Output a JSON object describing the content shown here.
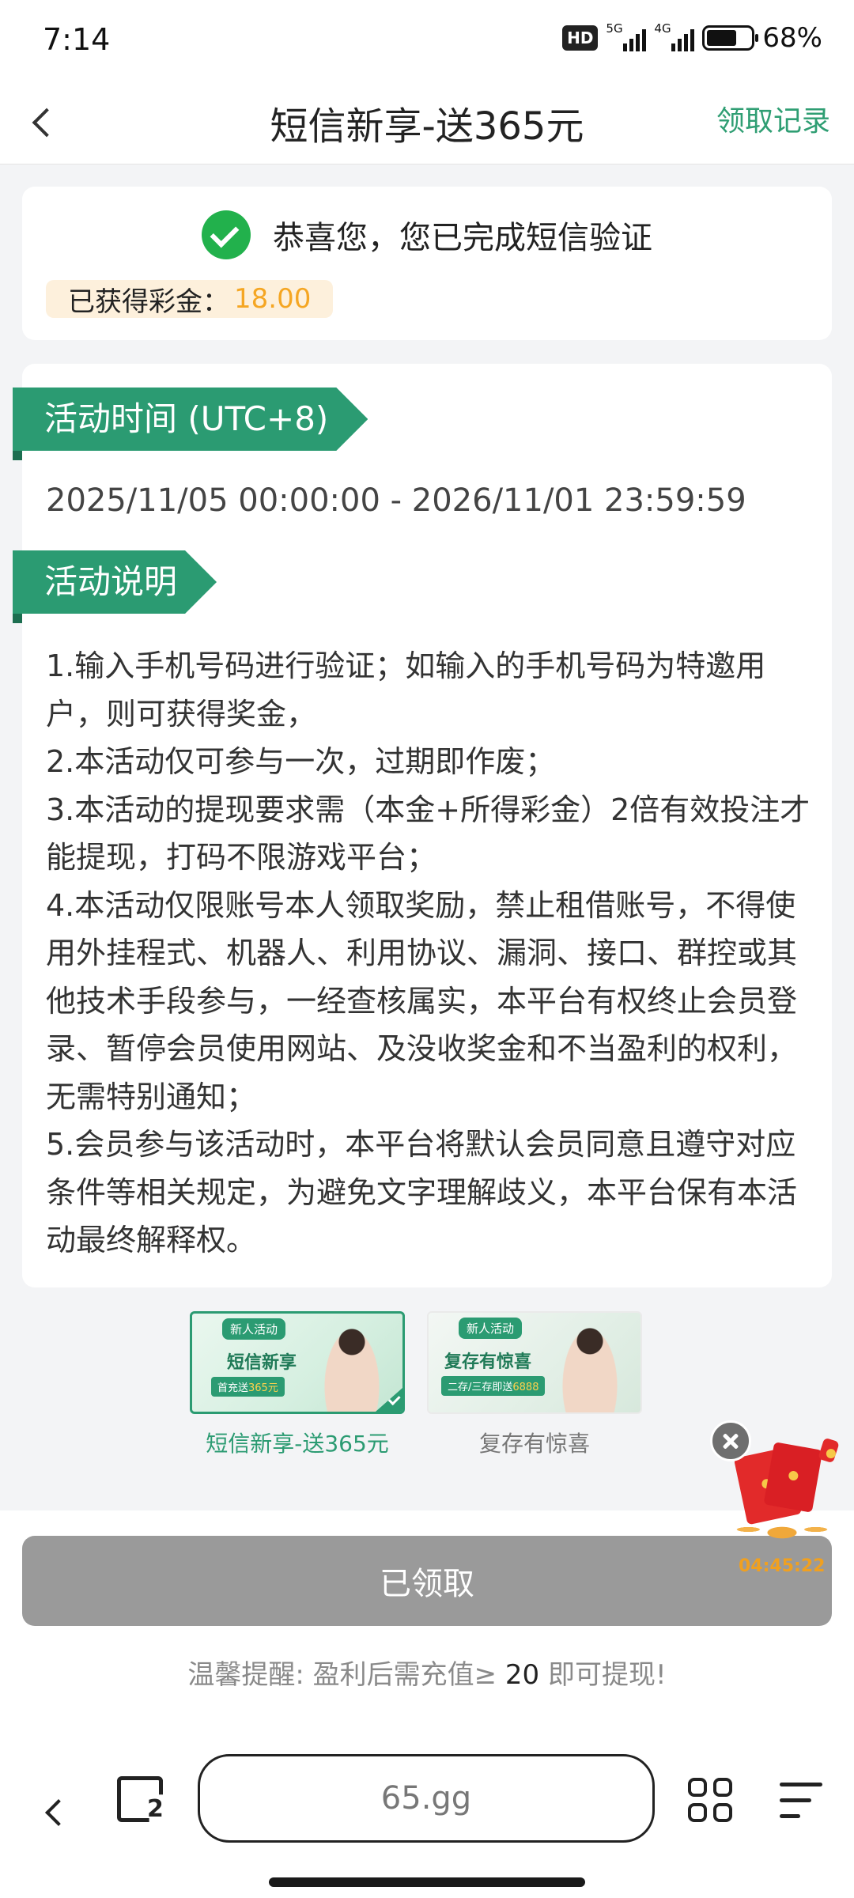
{
  "status_bar": {
    "time": "7:14",
    "hd_badge": "HD",
    "network1": "5G",
    "network2": "4G",
    "battery_level": 0.68,
    "battery_pct": "68%"
  },
  "header": {
    "title": "短信新享-送365元",
    "records_link": "领取记录"
  },
  "success_card": {
    "message": "恭喜您，您已完成短信验证",
    "bonus_label": "已获得彩金：",
    "bonus_value": "18.00"
  },
  "activity": {
    "time_heading": "活动时间 (UTC+8)",
    "time_range": "2025/11/05 00:00:00 - 2026/11/01 23:59:59",
    "desc_heading": "活动说明",
    "desc_lines": [
      "1.输入手机号码进行验证；如输入的手机号码为特邀用户，则可获得奖金，",
      "2.本活动仅可参与一次，过期即作废；",
      "3.本活动的提现要求需（本金+所得彩金）2倍有效投注才能提现，打码不限游戏平台；",
      "4.本活动仅限账号本人领取奖励，禁止租借账号，不得使用外挂程式、机器人、利用协议、漏洞、接口、群控或其他技术手段参与，一经查核属实，本平台有权终止会员登录、暂停会员使用网站、及没收奖金和不当盈利的权利，无需特别通知；",
      "5.会员参与该活动时，本平台将默认会员同意且遵守对应条件等相关规定，为避免文字理解歧义，本平台保有本活动最终解释权。"
    ]
  },
  "promos": [
    {
      "tag": "新人活动",
      "name": "短信新享",
      "sub_prefix": "首充送",
      "sub_value": "365元",
      "label": "短信新享-送365元",
      "selected": true
    },
    {
      "tag": "新人活动",
      "name": "复存有惊喜",
      "sub_prefix": "二存/三存即送",
      "sub_value": "6888",
      "label": "复存有惊喜",
      "selected": false
    }
  ],
  "floating": {
    "timer": "04:45:22"
  },
  "bottom": {
    "claim_button": "已领取",
    "tip_prefix": "温馨提醒: 盈利后需充值≥ ",
    "tip_amount": "20",
    "tip_suffix": " 即可提现!"
  },
  "browser": {
    "tab_count": "2",
    "url": "65.gg"
  },
  "colors": {
    "brand_green": "#2b9b72",
    "success_green": "#22b14c",
    "bonus_orange": "#f5a623",
    "disabled_gray": "#9a9a9a"
  }
}
